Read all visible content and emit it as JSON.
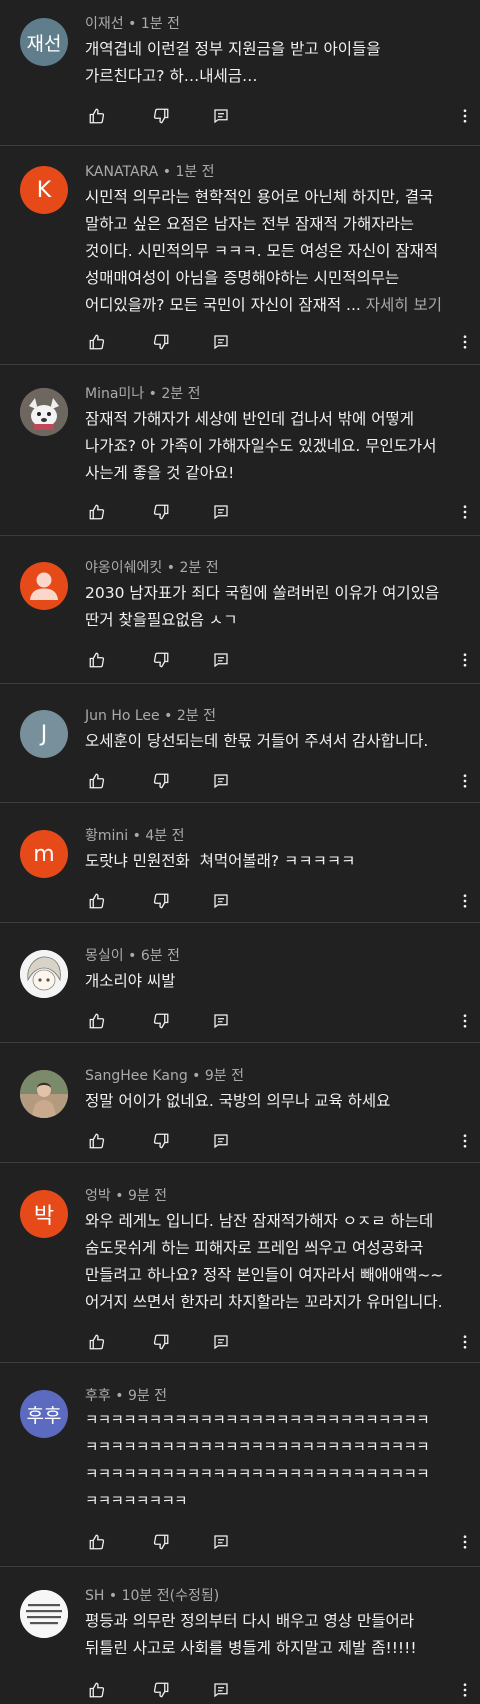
{
  "colors": {
    "background": "#212121",
    "text": "#f1f1f1",
    "meta": "#aaaaaa"
  },
  "comments": [
    {
      "author": "이재선",
      "time": "1분 전",
      "avatar_text": "재선",
      "avatar_color": "#607d8b",
      "text": "개역겹네 이런걸 정부 지원금을 받고 아이들을\n가르친다고? 하…내세금…"
    },
    {
      "author": "KANATARA",
      "time": "1분 전",
      "avatar_text": "K",
      "avatar_color": "#e64a19",
      "text": "시민적 의무라는 현학적인 용어로 아닌체 하지만, 결국\n말하고 싶은 요점은 남자는 전부 잠재적 가해자라는\n것이다. 시민적의무 ㅋㅋㅋ. 모든 여성은 자신이 잠재적\n성매매여성이 아님을 증명해야하는 시민적의무는\n어디있을까? 모든 국민이 자신이 잠재적 ... ",
      "more": "자세히 보기"
    },
    {
      "author": "Mina미나",
      "time": "2분 전",
      "avatar_text": "",
      "avatar_color": "#8a7f7a",
      "text": "잠재적 가해자가 세상에 반인데 겁나서 밖에 어떻게\n나가죠? 아 가족이 가해자일수도 있겠네요. 무인도가서\n사는게 좋을 것 같아요!"
    },
    {
      "author": "야옹이쉐에킷",
      "time": "2분 전",
      "avatar_text": "",
      "avatar_color": "#e64a19",
      "text": "2030 남자표가 죄다 국힘에 쏠려버린 이유가 여기있음\n딴거 찾을필요없음 ㅅㄱ"
    },
    {
      "author": "Jun Ho Lee",
      "time": "2분 전",
      "avatar_text": "J",
      "avatar_color": "#78909c",
      "text": "오세훈이 당선되는데 한몫 거들어 주셔서 감사합니다."
    },
    {
      "author": "황mini",
      "time": "4분 전",
      "avatar_text": "m",
      "avatar_color": "#e64a19",
      "text": "도랏냐 민원전화  쳐먹어볼래? ㅋㅋㅋㅋㅋ"
    },
    {
      "author": "몽실이",
      "time": "6분 전",
      "avatar_text": "",
      "avatar_color": "#f2f2f2",
      "text": "개소리야 씨발"
    },
    {
      "author": "SangHee Kang",
      "time": "9분 전",
      "avatar_text": "",
      "avatar_color": "#9b8b77",
      "text": "정말 어이가 없네요. 국방의 의무나 교육 하세요"
    },
    {
      "author": "엉박",
      "time": "9분 전",
      "avatar_text": "박",
      "avatar_color": "#e64a19",
      "text": "와우 레게노 입니다. 남잔 잠재적가해자 ㅇㅈㄹ 하는데\n숨도못쉬게 하는 피해자로 프레임 씌우고 여성공화국\n만들려고 하나요? 정작 본인들이 여자라서 빼애애액~~\n어거지 쓰면서 한자리 차지할라는 꼬라지가 유머입니다."
    },
    {
      "author": "후후",
      "time": "9분 전",
      "avatar_text": "후후",
      "avatar_color": "#5c6bc0",
      "text": "ㅋㅋㅋㅋㅋㅋㅋㅋㅋㅋㅋㅋㅋㅋㅋㅋㅋㅋㅋㅋㅋㅋㅋㅋㅋㅋㅋ\nㅋㅋㅋㅋㅋㅋㅋㅋㅋㅋㅋㅋㅋㅋㅋㅋㅋㅋㅋㅋㅋㅋㅋㅋㅋㅋㅋ\nㅋㅋㅋㅋㅋㅋㅋㅋㅋㅋㅋㅋㅋㅋㅋㅋㅋㅋㅋㅋㅋㅋㅋㅋㅋㅋㅋ\nㅋㅋㅋㅋㅋㅋㅋㅋ"
    },
    {
      "author": "SH",
      "time": "10분 전(수정됨)",
      "avatar_text": "",
      "avatar_color": "#f5f5f5",
      "avatar_logo_text": "",
      "text": "평등과 의무란 정의부터 다시 배우고 영상 만들어라\n뒤틀린 사고로 사회를 병들게 하지말고 제발 좀!!!!!"
    }
  ]
}
